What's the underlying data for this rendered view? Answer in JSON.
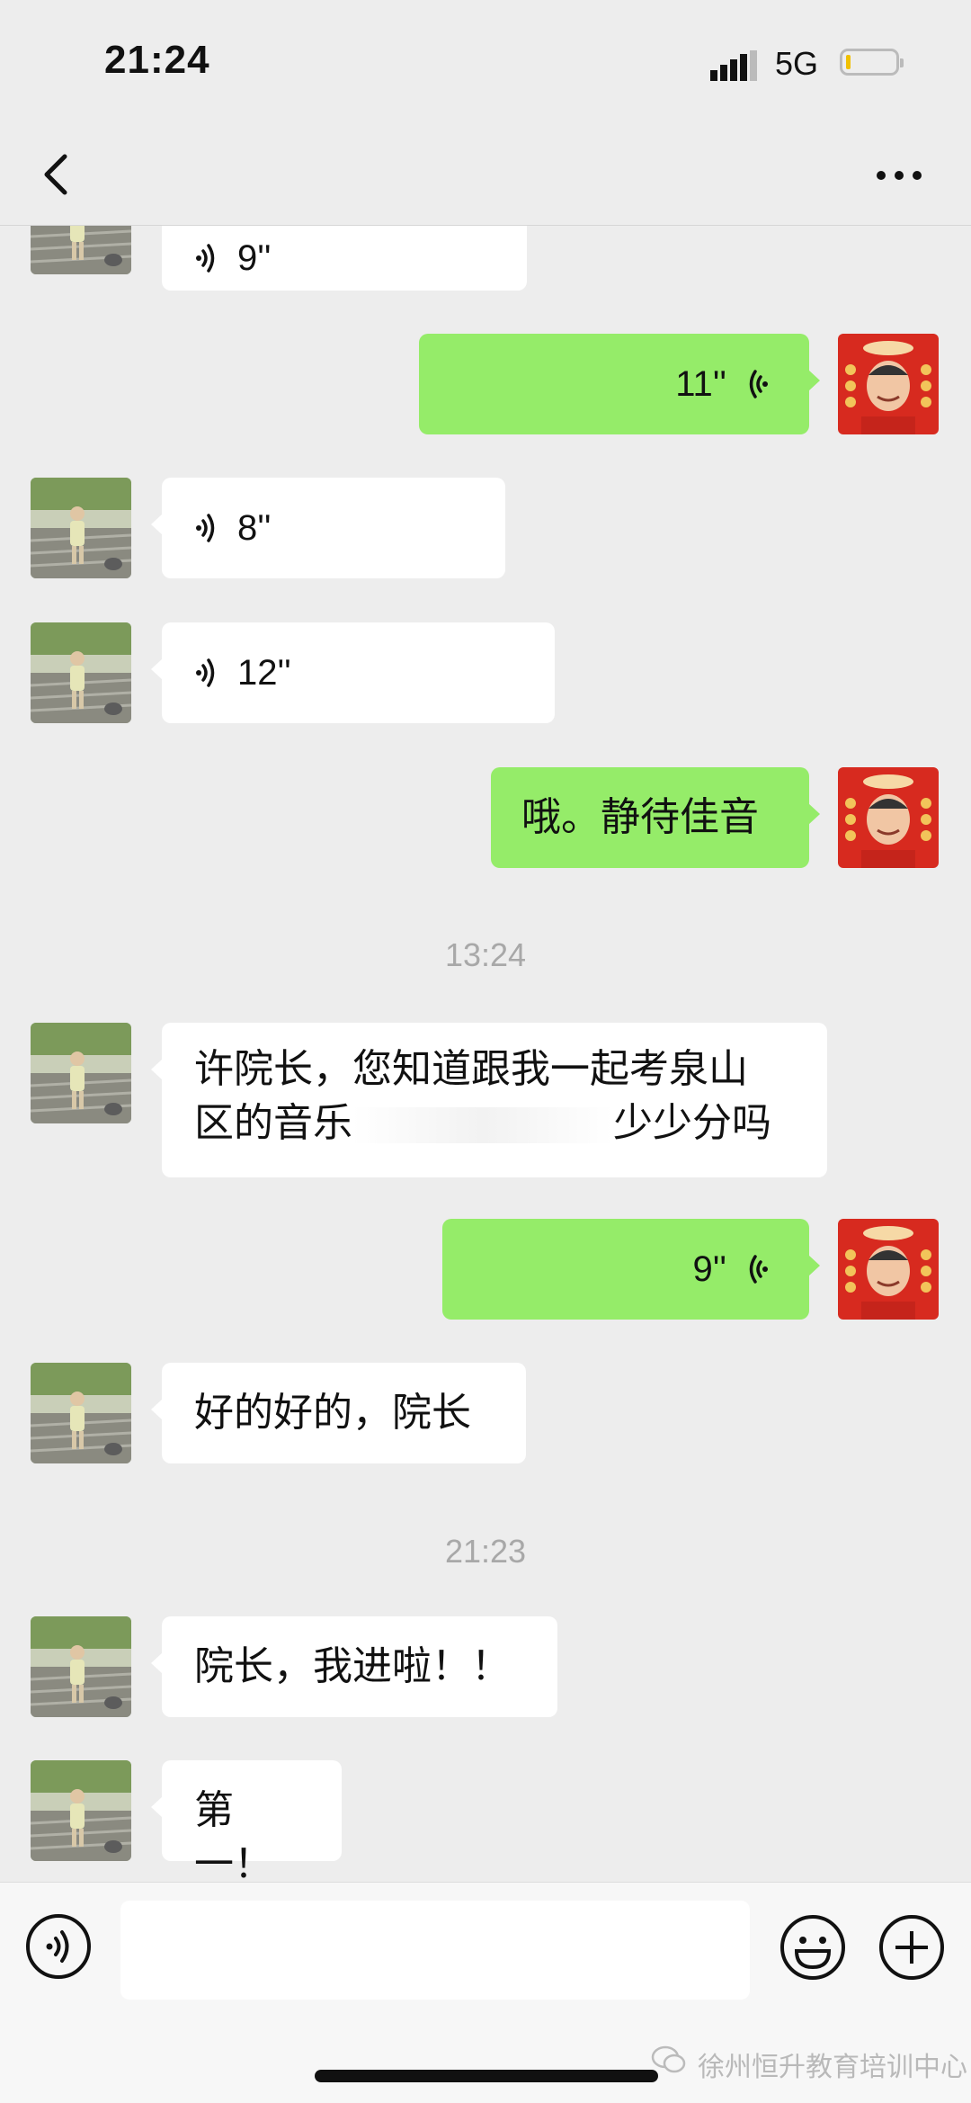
{
  "status_bar": {
    "time": "21:24",
    "network": "5G",
    "battery_level": 0.1
  },
  "header": {
    "title": "",
    "more_icon": "more-dots-icon",
    "back_icon": "chevron-left-icon"
  },
  "messages": [
    {
      "side": "left",
      "type": "voice",
      "duration": "9''"
    },
    {
      "side": "right",
      "type": "voice",
      "duration": "11''"
    },
    {
      "side": "left",
      "type": "voice",
      "duration": "8''"
    },
    {
      "side": "left",
      "type": "voice",
      "duration": "12''"
    },
    {
      "side": "right",
      "type": "text",
      "text": "哦。静待佳音"
    },
    {
      "type": "timestamp",
      "text": "13:24"
    },
    {
      "side": "left",
      "type": "text",
      "line1": "许院长，您知道跟我一起考泉山",
      "line2a": "区的音乐",
      "line2b": "少少分吗"
    },
    {
      "side": "right",
      "type": "voice",
      "duration": "9''"
    },
    {
      "side": "left",
      "type": "text",
      "text": "好的好的，院长"
    },
    {
      "type": "timestamp",
      "text": "21:23"
    },
    {
      "side": "left",
      "type": "text",
      "text": "院长，我进啦！！"
    },
    {
      "side": "left",
      "type": "text",
      "text": "第一！"
    }
  ],
  "input_bar": {
    "voice_icon": "voice-mode-icon",
    "emoji_icon": "emoji-icon",
    "plus_icon": "plus-icon"
  },
  "watermark": "徐州恒升教育培训中心",
  "colors": {
    "background": "#ededed",
    "sent_bubble": "#95ec69",
    "received_bubble": "#ffffff"
  }
}
